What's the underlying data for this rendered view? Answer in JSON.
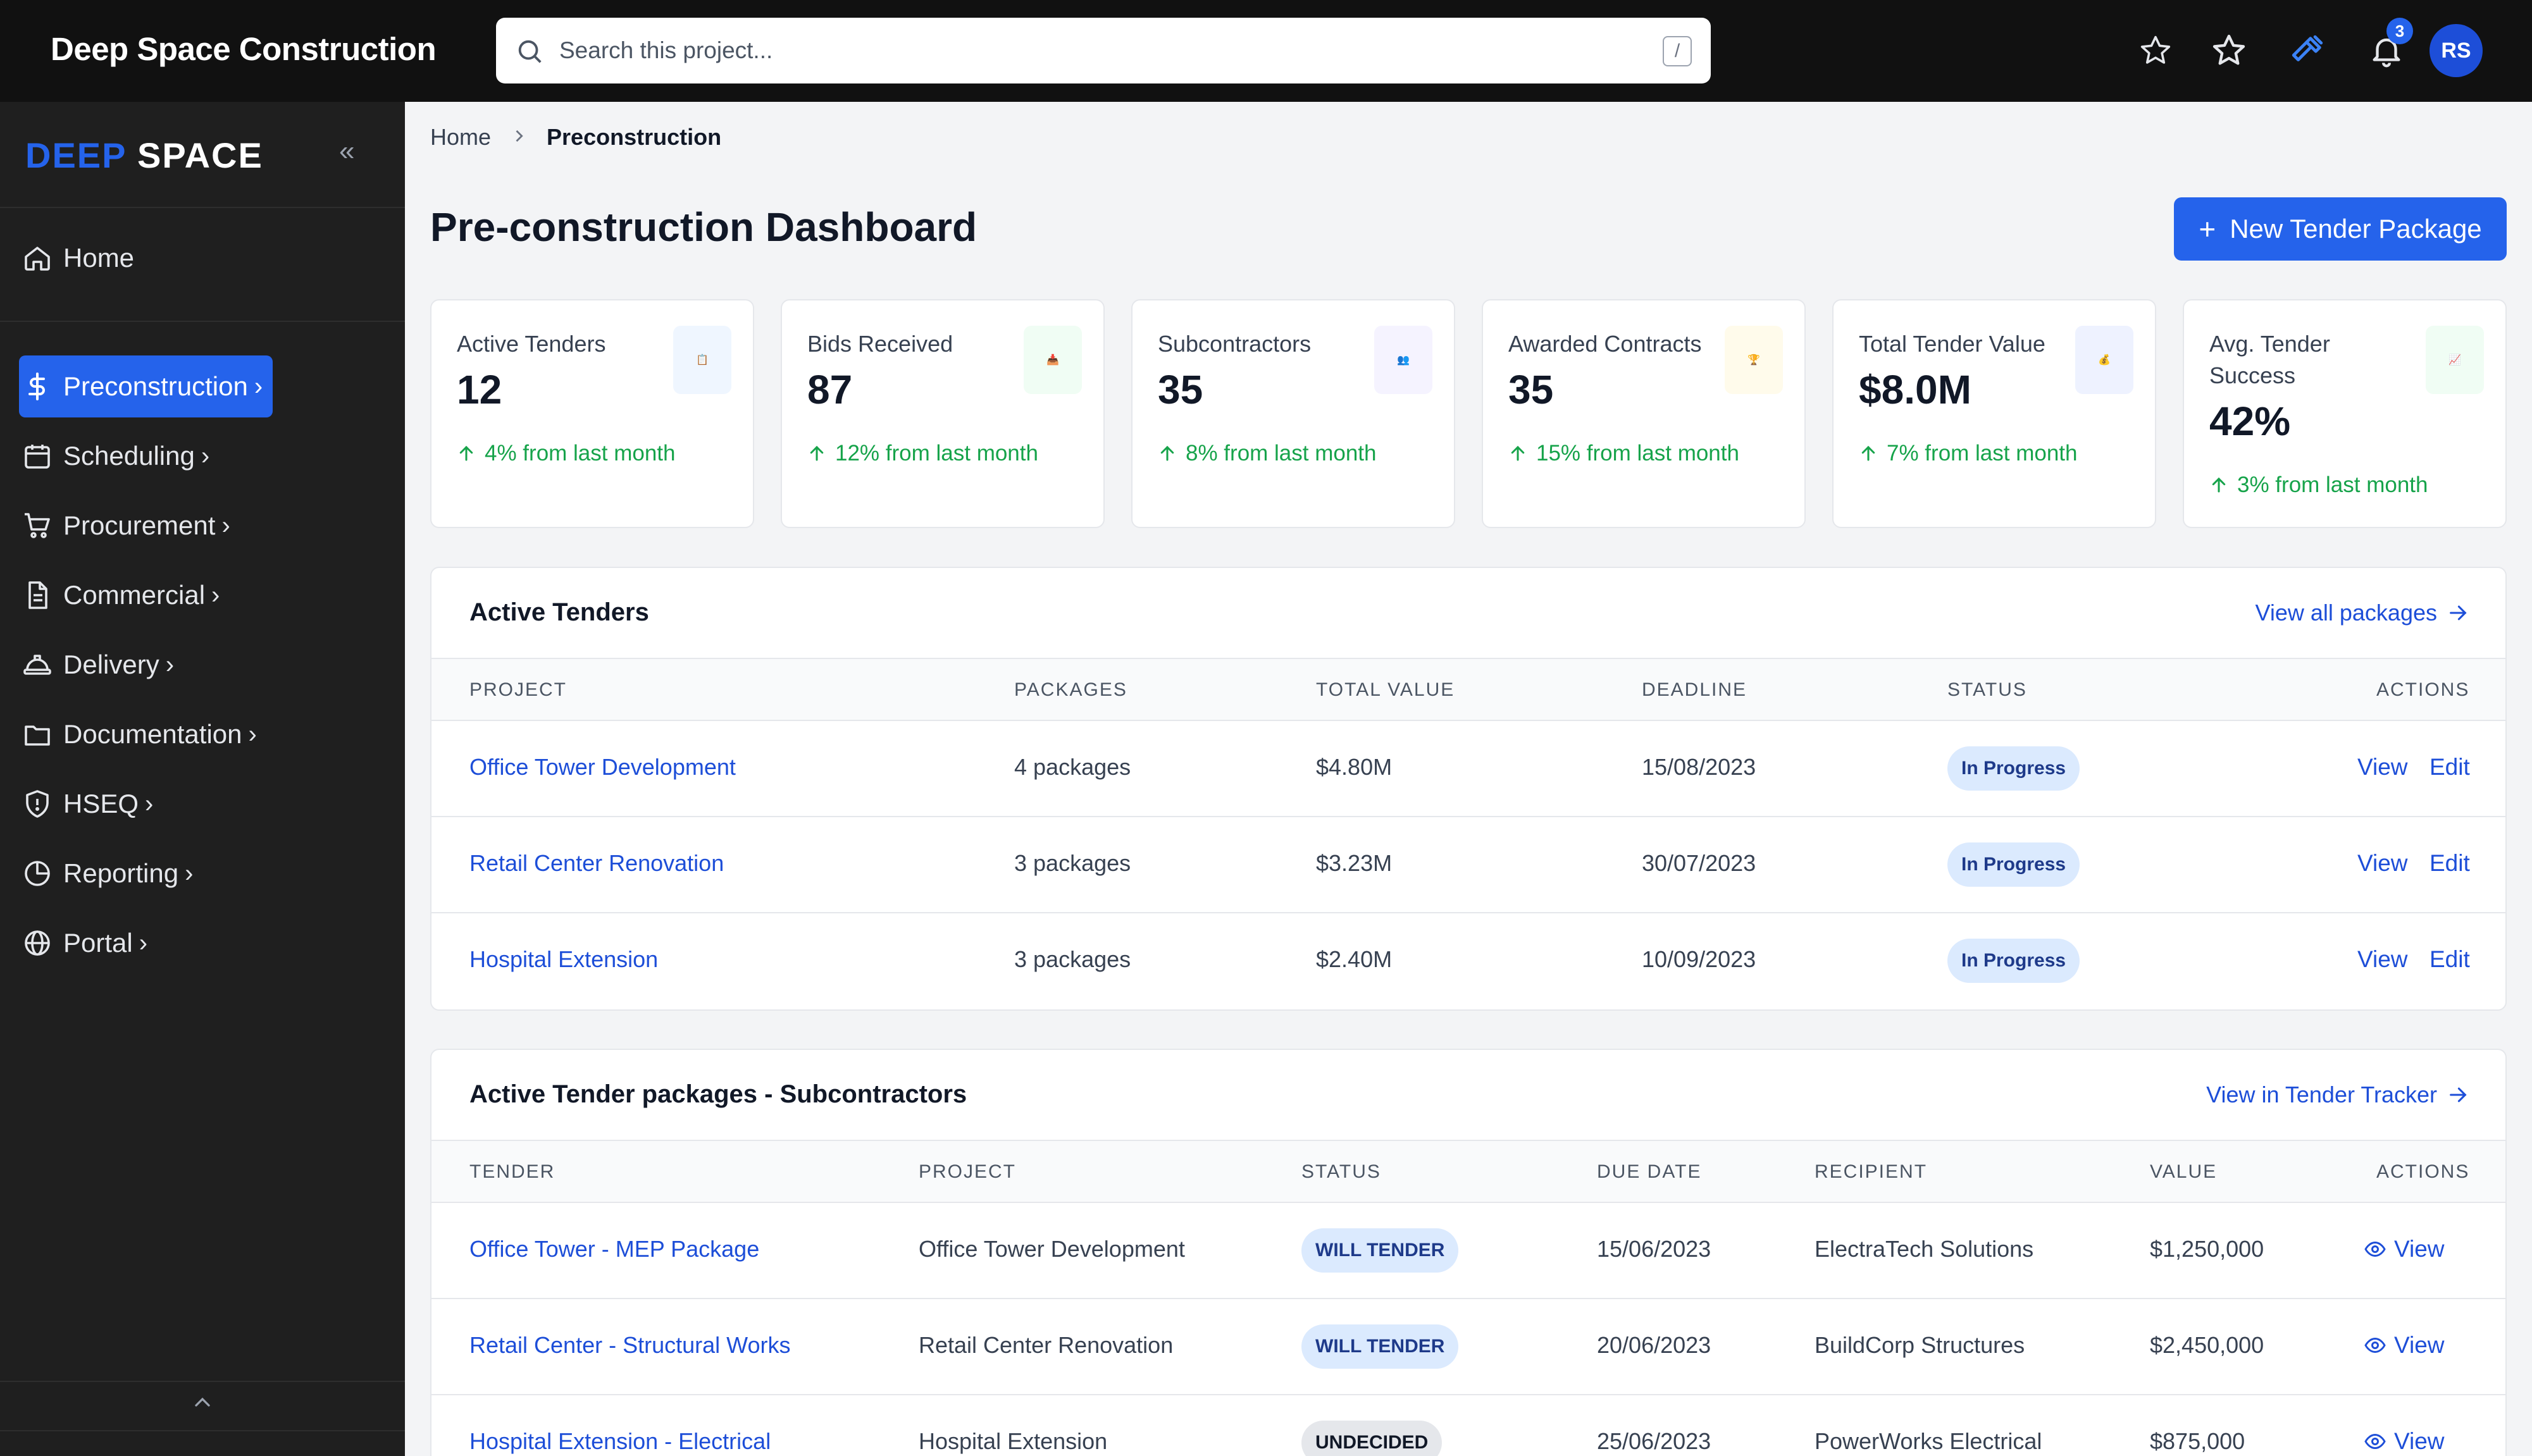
{
  "header": {
    "app_title": "Deep Space Construction",
    "search_placeholder": "Search this project...",
    "search_shortcut": "/",
    "icons": [
      "star-outline-icon",
      "star-icon",
      "hammer-icon",
      "bell-icon"
    ],
    "notification_count": "3",
    "avatar_initials": "RS"
  },
  "sidebar": {
    "logo_accent": "DEEP",
    "logo_rest": "SPACE",
    "collapse_glyph": "«",
    "home_label": "Home",
    "items": [
      {
        "label": "Preconstruction",
        "icon": "dollar-icon",
        "active": true
      },
      {
        "label": "Scheduling",
        "icon": "calendar-icon"
      },
      {
        "label": "Procurement",
        "icon": "cart-icon"
      },
      {
        "label": "Commercial",
        "icon": "document-icon"
      },
      {
        "label": "Delivery",
        "icon": "hardhat-icon"
      },
      {
        "label": "Documentation",
        "icon": "folder-icon"
      },
      {
        "label": "HSEQ",
        "icon": "shield-icon"
      },
      {
        "label": "Reporting",
        "icon": "pie-chart-icon"
      },
      {
        "label": "Portal",
        "icon": "globe-icon"
      }
    ],
    "chevron": "›"
  },
  "breadcrumb": {
    "home": "Home",
    "current": "Preconstruction"
  },
  "page": {
    "title": "Pre-construction Dashboard",
    "new_button_icon": "+",
    "new_button": "New Tender Package"
  },
  "stats": [
    {
      "label": "Active Tenders",
      "value": "12",
      "change": "4% from last month",
      "icon": "📋",
      "icon_bg": "#eff6ff"
    },
    {
      "label": "Bids Received",
      "value": "87",
      "change": "12% from last month",
      "icon": "📥",
      "icon_bg": "#f0fdf4"
    },
    {
      "label": "Subcontractors",
      "value": "35",
      "change": "8% from last month",
      "icon": "👥",
      "icon_bg": "#f5f3ff"
    },
    {
      "label": "Awarded Contracts",
      "value": "35",
      "change": "15% from last month",
      "icon": "🏆",
      "icon_bg": "#fffbeb"
    },
    {
      "label": "Total Tender Value",
      "value": "$8.0M",
      "change": "7% from last month",
      "icon": "💰",
      "icon_bg": "#eef2ff"
    },
    {
      "label": "Avg. Tender Success",
      "value": "42%",
      "change": "3% from last month",
      "icon": "📈",
      "icon_bg": "#f0fdf4"
    }
  ],
  "active_tenders": {
    "title": "Active Tenders",
    "link": "View all packages",
    "columns": [
      "PROJECT",
      "PACKAGES",
      "TOTAL VALUE",
      "DEADLINE",
      "STATUS",
      "ACTIONS"
    ],
    "rows": [
      {
        "project": "Office Tower Development",
        "packages": "4 packages",
        "value": "$4.80M",
        "deadline": "15/08/2023",
        "status": "In Progress"
      },
      {
        "project": "Retail Center Renovation",
        "packages": "3 packages",
        "value": "$3.23M",
        "deadline": "30/07/2023",
        "status": "In Progress"
      },
      {
        "project": "Hospital Extension",
        "packages": "3 packages",
        "value": "$2.40M",
        "deadline": "10/09/2023",
        "status": "In Progress"
      }
    ],
    "view_label": "View",
    "edit_label": "Edit"
  },
  "packages": {
    "title": "Active Tender packages - Subcontractors",
    "link": "View in Tender Tracker",
    "columns": [
      "TENDER",
      "PROJECT",
      "STATUS",
      "DUE DATE",
      "RECIPIENT",
      "VALUE",
      "ACTIONS"
    ],
    "rows": [
      {
        "tender": "Office Tower - MEP Package",
        "project": "Office Tower Development",
        "status": "WILL TENDER",
        "due": "15/06/2023",
        "recipient": "ElectraTech Solutions",
        "value": "$1,250,000"
      },
      {
        "tender": "Retail Center - Structural Works",
        "project": "Retail Center Renovation",
        "status": "WILL TENDER",
        "due": "20/06/2023",
        "recipient": "BuildCorp Structures",
        "value": "$2,450,000"
      },
      {
        "tender": "Hospital Extension - Electrical",
        "project": "Hospital Extension",
        "status": "UNDECIDED",
        "due": "25/06/2023",
        "recipient": "PowerWorks Electrical",
        "value": "$875,000"
      }
    ],
    "view_label": "View"
  },
  "colors": {
    "accent": "#2563eb",
    "link": "#1d4ed8",
    "positive": "#16a34a",
    "topbar": "#111111",
    "sidebar": "#1f1f1f"
  }
}
